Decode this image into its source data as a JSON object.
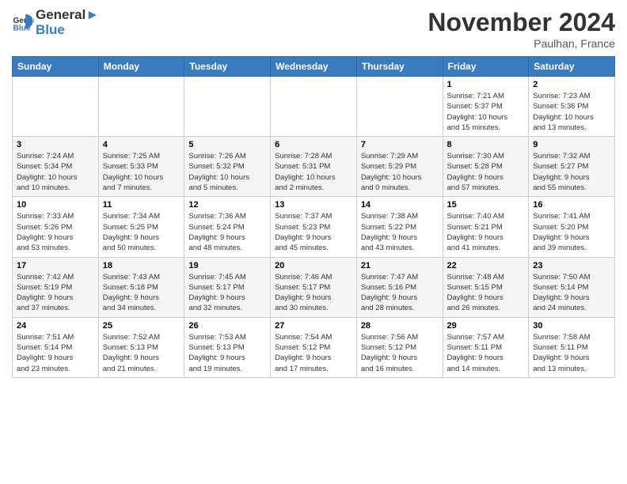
{
  "header": {
    "logo_general": "General",
    "logo_blue": "Blue",
    "month": "November 2024",
    "location": "Paulhan, France"
  },
  "weekdays": [
    "Sunday",
    "Monday",
    "Tuesday",
    "Wednesday",
    "Thursday",
    "Friday",
    "Saturday"
  ],
  "weeks": [
    [
      {
        "day": "",
        "info": ""
      },
      {
        "day": "",
        "info": ""
      },
      {
        "day": "",
        "info": ""
      },
      {
        "day": "",
        "info": ""
      },
      {
        "day": "",
        "info": ""
      },
      {
        "day": "1",
        "info": "Sunrise: 7:21 AM\nSunset: 5:37 PM\nDaylight: 10 hours\nand 15 minutes."
      },
      {
        "day": "2",
        "info": "Sunrise: 7:23 AM\nSunset: 5:36 PM\nDaylight: 10 hours\nand 13 minutes."
      }
    ],
    [
      {
        "day": "3",
        "info": "Sunrise: 7:24 AM\nSunset: 5:34 PM\nDaylight: 10 hours\nand 10 minutes."
      },
      {
        "day": "4",
        "info": "Sunrise: 7:25 AM\nSunset: 5:33 PM\nDaylight: 10 hours\nand 7 minutes."
      },
      {
        "day": "5",
        "info": "Sunrise: 7:26 AM\nSunset: 5:32 PM\nDaylight: 10 hours\nand 5 minutes."
      },
      {
        "day": "6",
        "info": "Sunrise: 7:28 AM\nSunset: 5:31 PM\nDaylight: 10 hours\nand 2 minutes."
      },
      {
        "day": "7",
        "info": "Sunrise: 7:29 AM\nSunset: 5:29 PM\nDaylight: 10 hours\nand 0 minutes."
      },
      {
        "day": "8",
        "info": "Sunrise: 7:30 AM\nSunset: 5:28 PM\nDaylight: 9 hours\nand 57 minutes."
      },
      {
        "day": "9",
        "info": "Sunrise: 7:32 AM\nSunset: 5:27 PM\nDaylight: 9 hours\nand 55 minutes."
      }
    ],
    [
      {
        "day": "10",
        "info": "Sunrise: 7:33 AM\nSunset: 5:26 PM\nDaylight: 9 hours\nand 53 minutes."
      },
      {
        "day": "11",
        "info": "Sunrise: 7:34 AM\nSunset: 5:25 PM\nDaylight: 9 hours\nand 50 minutes."
      },
      {
        "day": "12",
        "info": "Sunrise: 7:36 AM\nSunset: 5:24 PM\nDaylight: 9 hours\nand 48 minutes."
      },
      {
        "day": "13",
        "info": "Sunrise: 7:37 AM\nSunset: 5:23 PM\nDaylight: 9 hours\nand 45 minutes."
      },
      {
        "day": "14",
        "info": "Sunrise: 7:38 AM\nSunset: 5:22 PM\nDaylight: 9 hours\nand 43 minutes."
      },
      {
        "day": "15",
        "info": "Sunrise: 7:40 AM\nSunset: 5:21 PM\nDaylight: 9 hours\nand 41 minutes."
      },
      {
        "day": "16",
        "info": "Sunrise: 7:41 AM\nSunset: 5:20 PM\nDaylight: 9 hours\nand 39 minutes."
      }
    ],
    [
      {
        "day": "17",
        "info": "Sunrise: 7:42 AM\nSunset: 5:19 PM\nDaylight: 9 hours\nand 37 minutes."
      },
      {
        "day": "18",
        "info": "Sunrise: 7:43 AM\nSunset: 5:18 PM\nDaylight: 9 hours\nand 34 minutes."
      },
      {
        "day": "19",
        "info": "Sunrise: 7:45 AM\nSunset: 5:17 PM\nDaylight: 9 hours\nand 32 minutes."
      },
      {
        "day": "20",
        "info": "Sunrise: 7:46 AM\nSunset: 5:17 PM\nDaylight: 9 hours\nand 30 minutes."
      },
      {
        "day": "21",
        "info": "Sunrise: 7:47 AM\nSunset: 5:16 PM\nDaylight: 9 hours\nand 28 minutes."
      },
      {
        "day": "22",
        "info": "Sunrise: 7:48 AM\nSunset: 5:15 PM\nDaylight: 9 hours\nand 26 minutes."
      },
      {
        "day": "23",
        "info": "Sunrise: 7:50 AM\nSunset: 5:14 PM\nDaylight: 9 hours\nand 24 minutes."
      }
    ],
    [
      {
        "day": "24",
        "info": "Sunrise: 7:51 AM\nSunset: 5:14 PM\nDaylight: 9 hours\nand 23 minutes."
      },
      {
        "day": "25",
        "info": "Sunrise: 7:52 AM\nSunset: 5:13 PM\nDaylight: 9 hours\nand 21 minutes."
      },
      {
        "day": "26",
        "info": "Sunrise: 7:53 AM\nSunset: 5:13 PM\nDaylight: 9 hours\nand 19 minutes."
      },
      {
        "day": "27",
        "info": "Sunrise: 7:54 AM\nSunset: 5:12 PM\nDaylight: 9 hours\nand 17 minutes."
      },
      {
        "day": "28",
        "info": "Sunrise: 7:56 AM\nSunset: 5:12 PM\nDaylight: 9 hours\nand 16 minutes."
      },
      {
        "day": "29",
        "info": "Sunrise: 7:57 AM\nSunset: 5:11 PM\nDaylight: 9 hours\nand 14 minutes."
      },
      {
        "day": "30",
        "info": "Sunrise: 7:58 AM\nSunset: 5:11 PM\nDaylight: 9 hours\nand 13 minutes."
      }
    ]
  ]
}
